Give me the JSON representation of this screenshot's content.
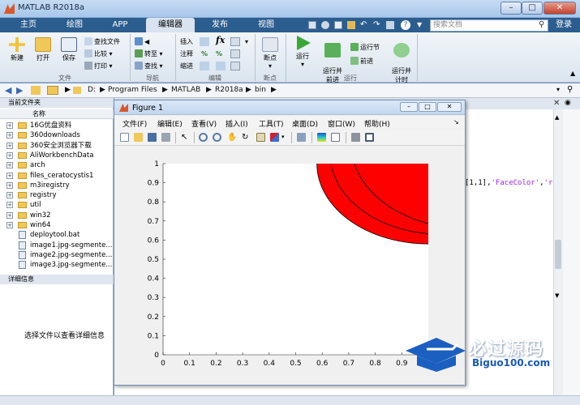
{
  "app": {
    "title": "MATLAB R2018a"
  },
  "tabs": [
    {
      "label": "主页"
    },
    {
      "label": "绘图"
    },
    {
      "label": "APP"
    },
    {
      "label": "编辑器"
    },
    {
      "label": "发布"
    },
    {
      "label": "视图"
    }
  ],
  "search": {
    "placeholder": "搜索文档"
  },
  "login": {
    "label": "登录"
  },
  "ribbon": {
    "file": {
      "label": "文件",
      "new": "新建",
      "open": "打开",
      "save": "保存",
      "find_files": "查找文件",
      "compare": "比较",
      "print": "打印"
    },
    "nav": {
      "label": "导航",
      "goto": "转至",
      "find": "查找"
    },
    "edit": {
      "label": "编辑",
      "insert": "插入",
      "comment": "注释",
      "indent": "缩进"
    },
    "breakpoints": {
      "label": "断点",
      "breakpoints": "断点"
    },
    "run": {
      "label": "运行",
      "run": "运行",
      "run_advance": "运行并\n前进",
      "run_section": "运行节",
      "advance": "前进",
      "run_time": "运行并\n计时"
    }
  },
  "path": {
    "segments": [
      "D:",
      "Program Files",
      "MATLAB",
      "R2018a",
      "bin"
    ]
  },
  "file_panel": {
    "title": "当前文件夹",
    "name_header": "名称",
    "items": [
      {
        "name": "16G优盘资料",
        "type": "folder"
      },
      {
        "name": "360downloads",
        "type": "folder"
      },
      {
        "name": "360安全浏览器下载",
        "type": "folder"
      },
      {
        "name": "AliWorkbenchData",
        "type": "folder"
      },
      {
        "name": "arch",
        "type": "folder"
      },
      {
        "name": "files_ceratocystis1",
        "type": "folder"
      },
      {
        "name": "m3iregistry",
        "type": "folder"
      },
      {
        "name": "registry",
        "type": "folder"
      },
      {
        "name": "util",
        "type": "folder"
      },
      {
        "name": "win32",
        "type": "folder"
      },
      {
        "name": "win64",
        "type": "folder"
      },
      {
        "name": "deploytool.bat",
        "type": "file"
      },
      {
        "name": "image1.jpg-segmente...",
        "type": "file"
      },
      {
        "name": "image2.jpg-segmente...",
        "type": "file"
      },
      {
        "name": "image3.jpg-segmente...",
        "type": "file"
      }
    ]
  },
  "detail_panel": {
    "title": "详细信息",
    "hint": "选择文件以查看详细信息"
  },
  "command_window": {
    "code_prefix": "[1,1],",
    "code_str1": "'FaceColor'",
    "code_sep": ",",
    "code_str2": "'r'"
  },
  "figure": {
    "title": "Figure 1",
    "menus": [
      "文件(F)",
      "编辑(E)",
      "查看(V)",
      "插入(I)",
      "工具(T)",
      "桌面(D)",
      "窗口(W)",
      "帮助(H)"
    ]
  },
  "chart_data": {
    "type": "area",
    "title": "",
    "xlabel": "",
    "ylabel": "",
    "xlim": [
      0,
      1
    ],
    "ylim": [
      0,
      1
    ],
    "grid": false,
    "xticks": [
      "0",
      "0.1",
      "0.2",
      "0.3",
      "0.4",
      "0.5",
      "0.6",
      "0.7",
      "0.8",
      "0.9"
    ],
    "yticks": [
      "0",
      "0.1",
      "0.2",
      "0.3",
      "0.4",
      "0.5",
      "0.6",
      "0.7",
      "0.8",
      "0.9",
      "1"
    ],
    "shapes": [
      {
        "kind": "circle",
        "center": [
          1,
          1
        ],
        "radius": 0.42,
        "facecolor": "#ff0000",
        "edgecolor": "#000000"
      },
      {
        "kind": "circle",
        "center": [
          1.05,
          1.05
        ],
        "radius": 0.42,
        "facecolor": "#ff0000",
        "edgecolor": "#000000"
      },
      {
        "kind": "circle",
        "center": [
          1.15,
          1.1
        ],
        "radius": 0.44,
        "facecolor": "#ff0000",
        "edgecolor": "#000000"
      }
    ]
  },
  "watermark": {
    "text": "必过源码",
    "url": "Biguo100.com"
  },
  "colors": {
    "accent": "#2c5d8f",
    "plot_fill": "#ff0000"
  }
}
